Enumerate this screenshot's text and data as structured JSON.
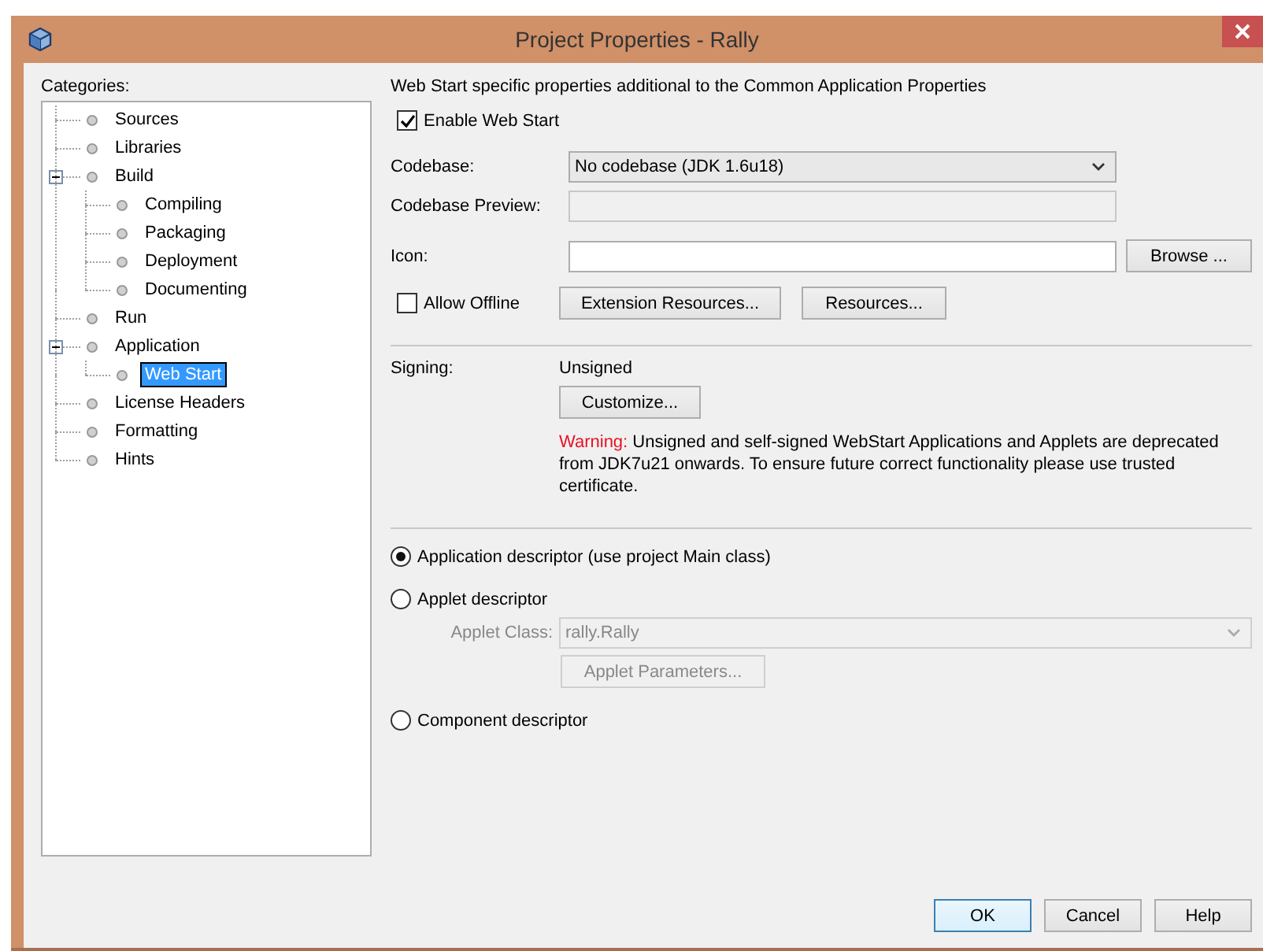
{
  "window": {
    "title": "Project Properties - Rally"
  },
  "categories": {
    "label": "Categories:",
    "items": [
      {
        "label": "Sources",
        "selected": false
      },
      {
        "label": "Libraries",
        "selected": false
      },
      {
        "label": "Build",
        "selected": false,
        "expanded": true,
        "children": [
          {
            "label": "Compiling",
            "selected": false
          },
          {
            "label": "Packaging",
            "selected": false
          },
          {
            "label": "Deployment",
            "selected": false
          },
          {
            "label": "Documenting",
            "selected": false
          }
        ]
      },
      {
        "label": "Run",
        "selected": false
      },
      {
        "label": "Application",
        "selected": false,
        "expanded": true,
        "children": [
          {
            "label": "Web Start",
            "selected": true
          }
        ]
      },
      {
        "label": "License Headers",
        "selected": false
      },
      {
        "label": "Formatting",
        "selected": false
      },
      {
        "label": "Hints",
        "selected": false
      }
    ]
  },
  "web_start": {
    "description": "Web Start specific properties additional to the Common Application Properties",
    "enable": {
      "label": "Enable Web Start",
      "checked": true
    },
    "codebase": {
      "label": "Codebase:",
      "value": "No codebase (JDK 1.6u18)"
    },
    "codebase_preview": {
      "label": "Codebase Preview:",
      "disabled": true
    },
    "icon": {
      "label": "Icon:",
      "browse": "Browse ..."
    },
    "allow_offline": {
      "label": "Allow Offline",
      "checked": false
    },
    "extension_resources": "Extension Resources...",
    "resources": "Resources..."
  },
  "signing": {
    "label": "Signing:",
    "value": "Unsigned",
    "button": "Customize...",
    "warning_prefix": "Warning:",
    "warning": "Unsigned and self-signed WebStart Applications and Applets are deprecated from JDK7u21 onwards. To ensure future correct functionality please use trusted certificate."
  },
  "descriptors": [
    {
      "label": "Application descriptor (use project Main class)",
      "selected": true
    },
    {
      "label": "Applet descriptor",
      "selected": false,
      "applet_class": {
        "label": "Applet Class:",
        "value": "rally.Rally",
        "disabled": true
      },
      "parameters_button": {
        "label": "Applet Parameters...",
        "disabled": true
      }
    },
    {
      "label": "Component descriptor",
      "selected": false
    }
  ],
  "buttons": [
    {
      "label": "OK",
      "default": true
    },
    {
      "label": "Cancel",
      "default": false
    },
    {
      "label": "Help",
      "default": false
    }
  ]
}
